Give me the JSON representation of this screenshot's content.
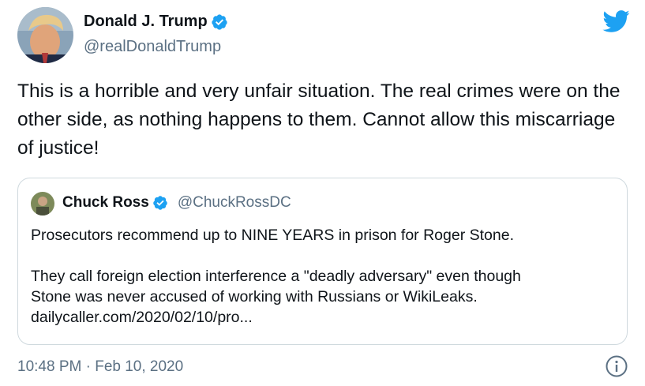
{
  "author": {
    "name": "Donald J. Trump",
    "handle": "@realDonaldTrump"
  },
  "tweet": {
    "text": "This is a horrible and very unfair situation. The real crimes were on the other side, as nothing happens to them. Cannot allow this miscarriage of justice!",
    "timestamp": "10:48 PM · Feb 10, 2020"
  },
  "quoted": {
    "name": "Chuck Ross",
    "handle": "@ChuckRossDC",
    "paragraph1": "Prosecutors recommend up to NINE YEARS in prison for Roger Stone.",
    "paragraph2_line1": "They call foreign election interference a \"deadly adversary\" even though",
    "paragraph2_line2": "Stone was never accused of working with Russians or WikiLeaks.",
    "paragraph2_line3": "dailycaller.com/2020/02/10/pro..."
  },
  "icons": {
    "verified": "verified-badge-icon",
    "bird": "twitter-bird-icon",
    "info": "info-icon"
  },
  "colors": {
    "brand": "#1da1f2",
    "secondary_text": "#5b7083",
    "border": "#cfd9de"
  }
}
